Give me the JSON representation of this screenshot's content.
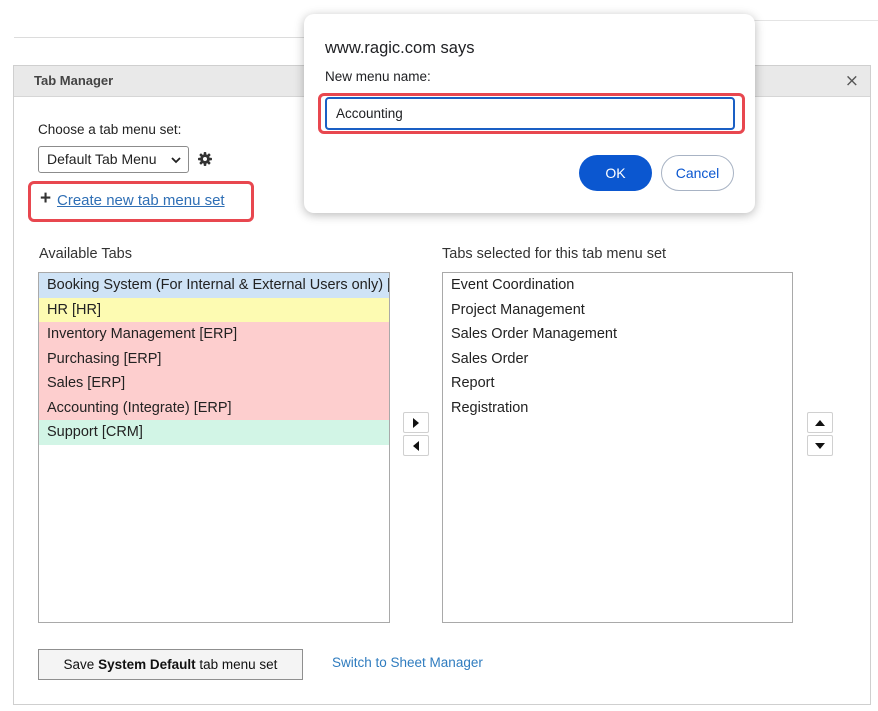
{
  "dialog": {
    "title": "Tab Manager",
    "close_glyph": "×",
    "choose_label": "Choose a tab menu set:",
    "selected_set": "Default Tab Menu",
    "create_plus": "+",
    "create_link": "Create new tab menu set",
    "available_label": "Available Tabs",
    "selected_label": "Tabs selected for this tab menu set",
    "available_tabs": [
      {
        "label": "Booking System (For Internal & External Users only) [",
        "color": "#cfe3f6"
      },
      {
        "label": "HR [HR]",
        "color": "#fdfbb2"
      },
      {
        "label": "Inventory Management [ERP]",
        "color": "#fdcece"
      },
      {
        "label": "Purchasing [ERP]",
        "color": "#fdcece"
      },
      {
        "label": "Sales [ERP]",
        "color": "#fdcece"
      },
      {
        "label": "Accounting (Integrate) [ERP]",
        "color": "#fdcece"
      },
      {
        "label": "Support [CRM]",
        "color": "#d2f5e6"
      }
    ],
    "selected_tabs": [
      "Event Coordination",
      "Project Management",
      "Sales Order Management",
      "Sales Order",
      "Report",
      "Registration"
    ],
    "save_prefix": "Save ",
    "save_bold": "System Default",
    "save_suffix": " tab menu set",
    "switch_link": "Switch to Sheet Manager"
  },
  "prompt": {
    "title": "www.ragic.com says",
    "message": "New menu name:",
    "input_value": "Accounting",
    "ok_label": "OK",
    "cancel_label": "Cancel"
  },
  "colors": {
    "highlight": "#e8474f",
    "link": "#2f6fb5",
    "primary_button": "#0b57d0"
  }
}
